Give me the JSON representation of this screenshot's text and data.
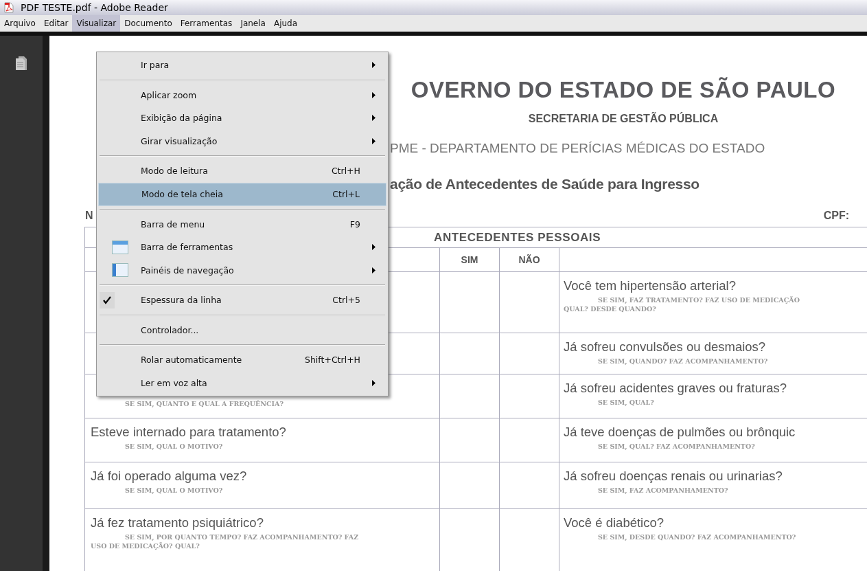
{
  "window": {
    "title": "PDF TESTE.pdf - Adobe Reader"
  },
  "menubar": [
    {
      "label": "Arquivo",
      "selected": false
    },
    {
      "label": "Editar",
      "selected": false
    },
    {
      "label": "Visualizar",
      "selected": true
    },
    {
      "label": "Documento",
      "selected": false
    },
    {
      "label": "Ferramentas",
      "selected": false
    },
    {
      "label": "Janela",
      "selected": false
    },
    {
      "label": "Ajuda",
      "selected": false
    }
  ],
  "menu": [
    {
      "kind": "item",
      "label": "Ir para",
      "submenu": true,
      "selected": false,
      "checked": false
    },
    {
      "kind": "separator"
    },
    {
      "kind": "item",
      "label": "Aplicar zoom",
      "submenu": true,
      "selected": false,
      "checked": false
    },
    {
      "kind": "item",
      "label": "Exibição da página",
      "submenu": true,
      "selected": false,
      "checked": false
    },
    {
      "kind": "item",
      "label": "Girar visualização",
      "submenu": true,
      "selected": false,
      "checked": false
    },
    {
      "kind": "separator"
    },
    {
      "kind": "item",
      "label": "Modo de leitura",
      "shortcut": "Ctrl+H",
      "submenu": false,
      "selected": false,
      "checked": false
    },
    {
      "kind": "item",
      "label": "Modo de tela cheia",
      "shortcut": "Ctrl+L",
      "submenu": false,
      "selected": true,
      "checked": false
    },
    {
      "kind": "separator"
    },
    {
      "kind": "item",
      "label": "Barra de menu",
      "shortcut": "F9",
      "submenu": false,
      "selected": false,
      "checked": false
    },
    {
      "kind": "toolbar",
      "label": "Barra de ferramentas",
      "submenu": true,
      "selected": false,
      "checked": false
    },
    {
      "kind": "panel",
      "label": "Painéis de navegação",
      "submenu": true,
      "selected": false,
      "checked": false
    },
    {
      "kind": "separator"
    },
    {
      "kind": "item",
      "label": "Espessura da linha",
      "shortcut": "Ctrl+5",
      "submenu": false,
      "selected": false,
      "checked": true
    },
    {
      "kind": "separator"
    },
    {
      "kind": "item",
      "label": "Controlador...",
      "submenu": false,
      "selected": false,
      "checked": false
    },
    {
      "kind": "separator"
    },
    {
      "kind": "item",
      "label": "Rolar automaticamente",
      "shortcut": "Shift+Ctrl+H",
      "submenu": false,
      "selected": false,
      "checked": false
    },
    {
      "kind": "item",
      "label": "Ler em voz alta",
      "submenu": true,
      "selected": false,
      "checked": false
    }
  ],
  "document": {
    "header": [
      "OVERNO DO ESTADO DE SÃO PAULO",
      "SECRETARIA DE GESTÃO PÚBLICA",
      "PME - DEPARTAMENTO DE PERÍCIAS MÉDICAS DO ESTADO",
      "ação de Antecedentes de Saúde para Ingresso"
    ],
    "name_label": "N",
    "cpf_label": "CPF:",
    "table": {
      "title": "ANTECEDENTES PESSOAIS",
      "columns": [
        "SIM",
        "NÃO"
      ],
      "rows": [
        {
          "right": {
            "question": "Você tem hipertensão arterial?",
            "note": "SE SIM, FAZ TRATAMENTO? FAZ USO DE MEDICAÇÃO",
            "note2": "QUAL? DESDE QUANDO?"
          }
        },
        {
          "right": {
            "question": "Já sofreu convulsões ou desmaios?",
            "note": "SE SIM, QUANDO? FAZ ACOMPANHAMENTO?"
          }
        },
        {
          "left": {
            "note": "SE SIM, QUANTO E QUAL A FREQUÊNCIA?"
          },
          "right": {
            "question": "Já sofreu acidentes graves ou fraturas?",
            "note": "SE SIM, QUAL?"
          }
        },
        {
          "left": {
            "question": "Esteve internado para tratamento?",
            "note": "SE SIM, QUAL O MOTIVO?"
          },
          "right": {
            "question": "Já teve doenças de pulmões ou brônquic",
            "note": "SE SIM, QUAL? FAZ ACOMPANHAMENTO?"
          }
        },
        {
          "left": {
            "question": "Já foi operado alguma vez?",
            "note": "SE SIM, QUAL O MOTIVO?"
          },
          "right": {
            "question": "Já sofreu doenças renais ou urinarias?",
            "note": "SE SIM, FAZ ACOMPANHAMENTO?"
          }
        },
        {
          "left": {
            "question": "Já fez tratamento psiquiátrico?",
            "note": "SE SIM, POR QUANTO TEMPO? FAZ ACOMPANHAMENTO? FAZ",
            "note2": "USO DE MEDICAÇÃO? QUAL?"
          },
          "right": {
            "question": "Você é diabético?",
            "note": "SE SIM, DESDE QUANDO? FAZ ACOMPANHAMENTO?"
          }
        }
      ]
    }
  }
}
